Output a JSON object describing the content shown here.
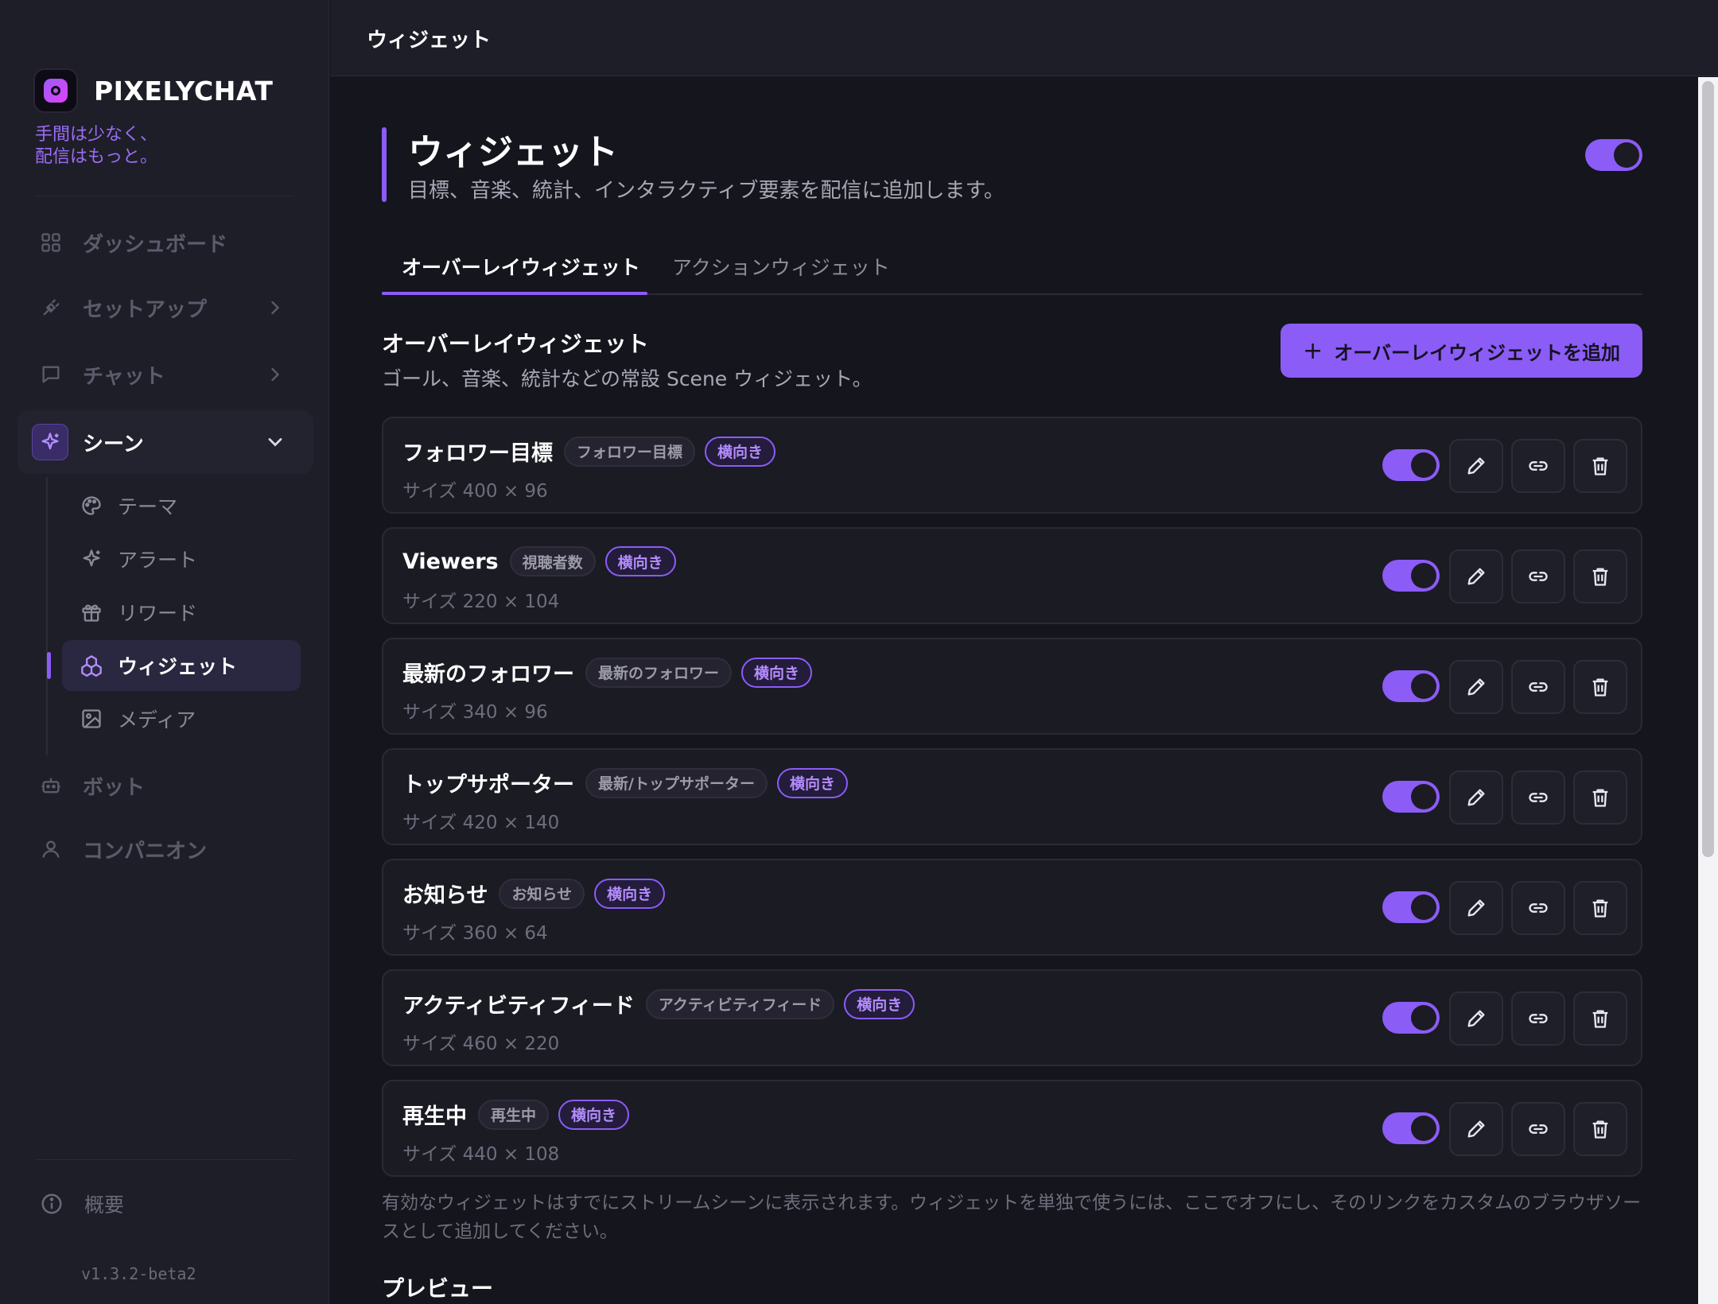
{
  "app": {
    "brand": "PIXELYCHAT",
    "tagline_line1": "手間は少なく、",
    "tagline_line2": "配信はもっと。",
    "version": "v1.3.2-beta2"
  },
  "topbar": {
    "title": "ウィジェット"
  },
  "sidebar": {
    "items": [
      {
        "label": "ダッシュボード",
        "icon": "dashboard-icon"
      },
      {
        "label": "セットアップ",
        "icon": "plug-icon"
      },
      {
        "label": "チャット",
        "icon": "chat-icon"
      },
      {
        "label": "シーン",
        "icon": "sparkles-icon"
      },
      {
        "label": "ボット",
        "icon": "bot-icon"
      },
      {
        "label": "コンパニオン",
        "icon": "user-icon"
      }
    ],
    "subitems": [
      {
        "label": "テーマ",
        "icon": "palette-icon"
      },
      {
        "label": "アラート",
        "icon": "sparkle-icon"
      },
      {
        "label": "リワード",
        "icon": "gift-icon"
      },
      {
        "label": "ウィジェット",
        "icon": "widgets-icon"
      },
      {
        "label": "メディア",
        "icon": "image-icon"
      }
    ],
    "about": "概要"
  },
  "page": {
    "title": "ウィジェット",
    "description": "目標、音楽、統計、インタラクティブ要素を配信に追加します。",
    "enabled": true
  },
  "tabs": [
    {
      "label": "オーバーレイウィジェット",
      "active": true
    },
    {
      "label": "アクションウィジェット",
      "active": false
    }
  ],
  "section": {
    "title": "オーバーレイウィジェット",
    "subtitle": "ゴール、音楽、統計などの常設 Scene ウィジェット。",
    "add_button": "オーバーレイウィジェットを追加"
  },
  "widgets": [
    {
      "name": "フォロワー目標",
      "type": "フォロワー目標",
      "orientation": "横向き",
      "size": "サイズ 400 × 96",
      "enabled": true
    },
    {
      "name": "Viewers",
      "type": "視聴者数",
      "orientation": "横向き",
      "size": "サイズ 220 × 104",
      "enabled": true
    },
    {
      "name": "最新のフォロワー",
      "type": "最新のフォロワー",
      "orientation": "横向き",
      "size": "サイズ 340 × 96",
      "enabled": true
    },
    {
      "name": "トップサポーター",
      "type": "最新/トップサポーター",
      "orientation": "横向き",
      "size": "サイズ 420 × 140",
      "enabled": true
    },
    {
      "name": "お知らせ",
      "type": "お知らせ",
      "orientation": "横向き",
      "size": "サイズ 360 × 64",
      "enabled": true
    },
    {
      "name": "アクティビティフィード",
      "type": "アクティビティフィード",
      "orientation": "横向き",
      "size": "サイズ 460 × 220",
      "enabled": true
    },
    {
      "name": "再生中",
      "type": "再生中",
      "orientation": "横向き",
      "size": "サイズ 440 × 108",
      "enabled": true
    }
  ],
  "footnote": "有効なウィジェットはすでにストリームシーンに表示されます。ウィジェットを単独で使うには、ここでオフにし、そのリンクをカスタムのブラウザソースとして追加してください。",
  "preview_title": "プレビュー",
  "colors": {
    "accent": "#8b5cf6",
    "background": "#15151d",
    "sidebar": "#1e1e28"
  }
}
